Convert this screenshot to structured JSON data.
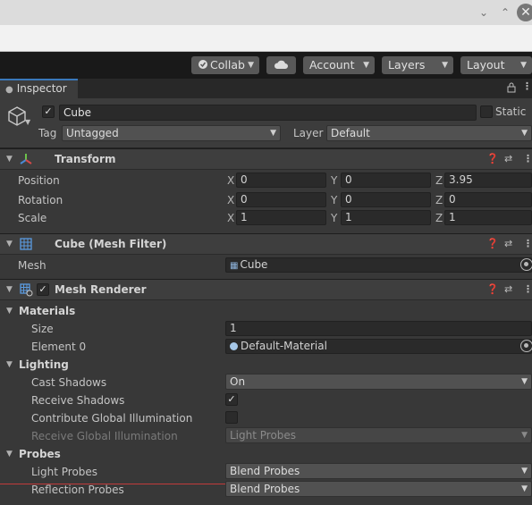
{
  "window": {
    "minimize_glyph": "⌄",
    "maximize_glyph": "⌃",
    "close_glyph": "✕"
  },
  "toolbar": {
    "collab": "Collab",
    "account": "Account",
    "layers": "Layers",
    "layout": "Layout"
  },
  "tab": {
    "label": "Inspector"
  },
  "gameobject": {
    "name": "Cube",
    "active": true,
    "static_label": "Static",
    "tag_label": "Tag",
    "tag_value": "Untagged",
    "layer_label": "Layer",
    "layer_value": "Default"
  },
  "transform": {
    "title": "Transform",
    "rows": [
      {
        "label": "Position",
        "x": "0",
        "y": "0",
        "z": "3.95"
      },
      {
        "label": "Rotation",
        "x": "0",
        "y": "0",
        "z": "0"
      },
      {
        "label": "Scale",
        "x": "1",
        "y": "1",
        "z": "1"
      }
    ],
    "axis": {
      "x": "X",
      "y": "Y",
      "z": "Z"
    }
  },
  "mesh_filter": {
    "title": "Cube (Mesh Filter)",
    "mesh_label": "Mesh",
    "mesh_value": "Cube"
  },
  "mesh_renderer": {
    "title": "Mesh Renderer",
    "materials": {
      "title": "Materials",
      "size_label": "Size",
      "size_value": "1",
      "element_label": "Element 0",
      "element_value": "Default-Material"
    },
    "lighting": {
      "title": "Lighting",
      "cast_shadows_label": "Cast Shadows",
      "cast_shadows_value": "On",
      "receive_shadows_label": "Receive Shadows",
      "contribute_gi_label": "Contribute Global Illumination",
      "receive_gi_label": "Receive Global Illumination",
      "receive_gi_value": "Light Probes"
    },
    "probes": {
      "title": "Probes",
      "light_probes_label": "Light Probes",
      "light_probes_value": "Blend Probes",
      "reflection_probes_label": "Reflection Probes",
      "reflection_probes_value": "Blend Probes"
    }
  },
  "colors": {
    "tab_accent": "#3a79bb",
    "background": "#383838",
    "field": "#2a2a2a"
  }
}
